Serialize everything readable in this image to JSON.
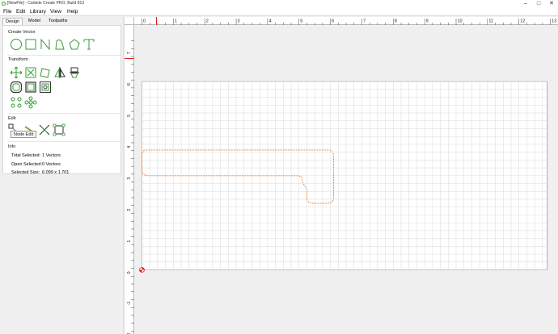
{
  "window": {
    "title": "[NewFile] - Carbide Create PRO, Build 813",
    "min": "–",
    "max": "□",
    "close": "✕"
  },
  "menu": [
    "File",
    "Edit",
    "Library",
    "View",
    "Help"
  ],
  "tabs": [
    "Design",
    "Model",
    "Toolpaths"
  ],
  "sections": {
    "create_vector": "Create Vector",
    "transform": "Transform",
    "edit": "Edit",
    "info": "Info"
  },
  "tools": {
    "create": [
      "circle-icon",
      "rectangle-icon",
      "polyline-icon",
      "curve-icon",
      "polygon-icon",
      "text-icon"
    ],
    "transform": [
      "move-icon",
      "scale-icon",
      "rotate-icon",
      "mirror-icon",
      "align-icon",
      "offset-icon",
      "boolean-union-icon",
      "boolean-subtract-icon",
      "circular-array-icon",
      "rectangular-array-icon"
    ],
    "edit": [
      "node-edit-icon",
      "trim-icon",
      "cut-icon",
      "bounding-box-icon"
    ]
  },
  "tooltip": "Node Edit",
  "info": [
    {
      "label": "Total Selected:",
      "value": "1 Vectors"
    },
    {
      "label": "Open Selected:",
      "value": "0 Vectors"
    },
    {
      "label": "Selected Size:",
      "value": "6.099 x 1.701"
    }
  ],
  "ruler": {
    "x_ticks": [
      "0",
      "1",
      "2",
      "3",
      "4",
      "5",
      "6",
      "7",
      "8",
      "9",
      "10",
      "11",
      "12",
      "13"
    ],
    "y_ticks": [
      "7",
      "6",
      "5",
      "4",
      "3",
      "2",
      "1",
      "0",
      "-1",
      "-2"
    ]
  },
  "colors": {
    "accent": "#3a9a3a",
    "vector": "#e8823a",
    "origin": "#e02020",
    "grid": "#d9d9d9"
  }
}
